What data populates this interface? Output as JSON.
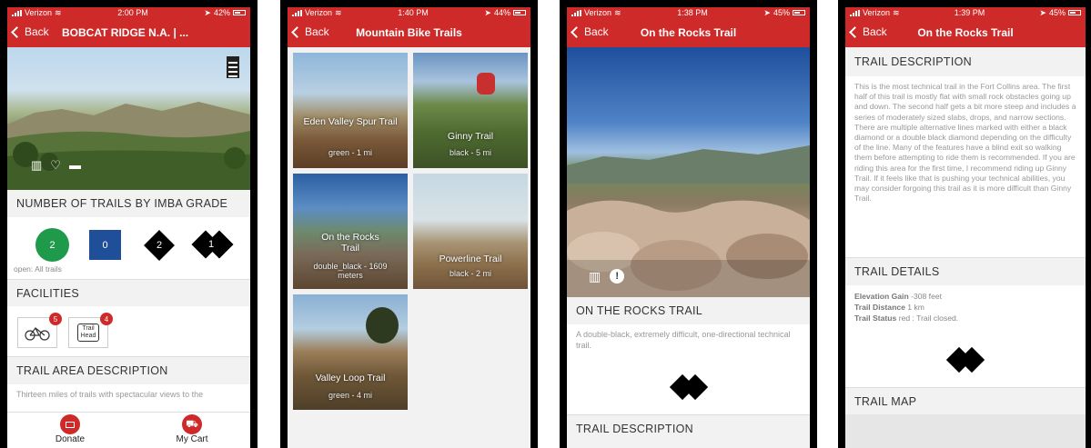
{
  "screens": [
    {
      "status": {
        "carrier": "Verizon",
        "time": "2:00 PM",
        "battery": "42%"
      },
      "nav": {
        "back": "Back",
        "title": "BOBCAT RIDGE N.A. | ..."
      },
      "grades_title": "NUMBER OF TRAILS BY IMBA GRADE",
      "grades": [
        {
          "value": "2",
          "shape": "green-circle",
          "color": "#1f9a4a"
        },
        {
          "value": "0",
          "shape": "blue-square",
          "color": "#1f4f99"
        },
        {
          "value": "2",
          "shape": "black-diamond"
        },
        {
          "value": "1",
          "shape": "double-black-diamond"
        }
      ],
      "open_text": "open: All trails",
      "facilities_title": "FACILITIES",
      "facilities": [
        {
          "icon": "bike-icon",
          "count": "5"
        },
        {
          "icon": "trail-head-icon",
          "label_line1": "Trail",
          "label_line2": "Head",
          "count": "4"
        }
      ],
      "area_desc_title": "TRAIL AREA DESCRIPTION",
      "area_desc_text": "Thirteen miles of trails with spectacular views to the",
      "footer": {
        "donate": "Donate",
        "cart": "My Cart"
      }
    },
    {
      "status": {
        "carrier": "Verizon",
        "time": "1:40 PM",
        "battery": "44%"
      },
      "nav": {
        "back": "Back",
        "title": "Mountain Bike Trails"
      },
      "trails": [
        {
          "name": "Eden Valley Spur Trail",
          "sub": "green - 1 mi"
        },
        {
          "name": "Ginny Trail",
          "sub": "black - 5 mi"
        },
        {
          "name": "On the Rocks Trail",
          "sub": "double_black - 1609 meters"
        },
        {
          "name": "Powerline Trail",
          "sub": "black - 2 mi"
        },
        {
          "name": "Valley Loop Trail",
          "sub": "green - 4 mi"
        }
      ]
    },
    {
      "status": {
        "carrier": "Verizon",
        "time": "1:38 PM",
        "battery": "45%"
      },
      "nav": {
        "back": "Back",
        "title": "On the Rocks Trail"
      },
      "heading": "ON THE ROCKS TRAIL",
      "summary": "A double-black, extremely difficult, one-directional technical trail.",
      "next_section": "TRAIL DESCRIPTION"
    },
    {
      "status": {
        "carrier": "Verizon",
        "time": "1:39 PM",
        "battery": "45%"
      },
      "nav": {
        "back": "Back",
        "title": "On the Rocks Trail"
      },
      "desc_title": "TRAIL DESCRIPTION",
      "desc_text": "This is the most technical trail in the Fort Collins area. The first half of this trail is mostly flat with small rock obstacles going up and down. The second half gets a bit more steep and includes a series of moderately sized slabs, drops, and narrow sections. There are multiple alternative lines marked with either a black diamond or a double black diamond depending on the difficulty of the line. Many of the features have a blind exit so walking them before attempting to ride them is recommended. If you are riding this area for the first time, I recommend riding up Ginny Trail. If it feels like that is pushing your technical abilities, you may consider forgoing this trail as it is more difficult than Ginny Trail.",
      "details_title": "TRAIL DETAILS",
      "details": [
        {
          "label": "Elevation Gain",
          "value": " -308 feet"
        },
        {
          "label": "Trail Distance",
          "value": " 1 km"
        },
        {
          "label": "Trail Status",
          "value": " red : Trail closed."
        }
      ],
      "map_title": "TRAIL MAP"
    }
  ]
}
